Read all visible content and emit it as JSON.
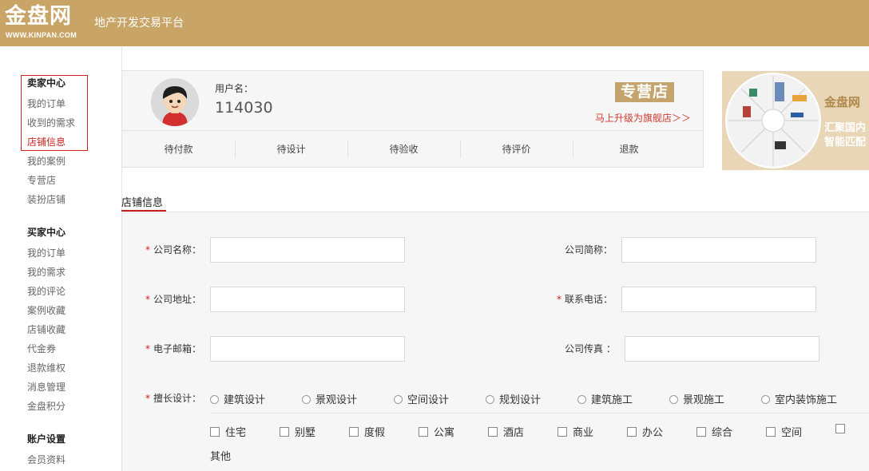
{
  "header": {
    "logo_text": "金盘网",
    "logo_url_text": "WWW.KINPAN.COM",
    "platform_title": "地产开发交易平台"
  },
  "sidebar": {
    "seller_center": {
      "title": "卖家中心",
      "items": [
        "我的订单",
        "收到的需求",
        "店铺信息",
        "我的案例",
        "专营店",
        "装扮店铺"
      ]
    },
    "buyer_center": {
      "title": "买家中心",
      "items": [
        "我的订单",
        "我的需求",
        "我的评论",
        "案例收藏",
        "店铺收藏",
        "代金券",
        "退款维权",
        "消息管理",
        "金盘积分"
      ]
    },
    "account": {
      "title": "账户设置",
      "items": [
        "会员资料"
      ]
    }
  },
  "user": {
    "username_label": "用户名：",
    "username": "114030",
    "shop_badge": "专营店",
    "upgrade_link": "马上升级为旗舰店＞＞",
    "order_tabs": [
      "待付款",
      "待设计",
      "待验收",
      "待评价",
      "退款"
    ]
  },
  "banner": {
    "brand": "金盘网",
    "line1": "汇聚国内",
    "line2": "智能匹配"
  },
  "section": {
    "tab_label": "店铺信息"
  },
  "form": {
    "company_name_label": "公司名称：",
    "company_short_label": "公司简称：",
    "company_address_label": "公司地址：",
    "phone_label": "联系电话：",
    "email_label": "电子邮箱：",
    "fax_label": "公司传真 ：",
    "specialty_label": "擅长设计：",
    "required_mark": "*",
    "specialty_options": [
      "建筑设计",
      "景观设计",
      "空间设计",
      "规划设计",
      "建筑施工",
      "景观施工",
      "室内装饰施工"
    ],
    "category_options": [
      "住宅",
      "别墅",
      "度假",
      "公寓",
      "酒店",
      "商业",
      "办公",
      "综合",
      "空间"
    ],
    "category_overflow": "其他"
  },
  "colors": {
    "header_bg": "#c9a467",
    "accent_red": "#c8211d",
    "badge_gold": "#c4a46c"
  }
}
